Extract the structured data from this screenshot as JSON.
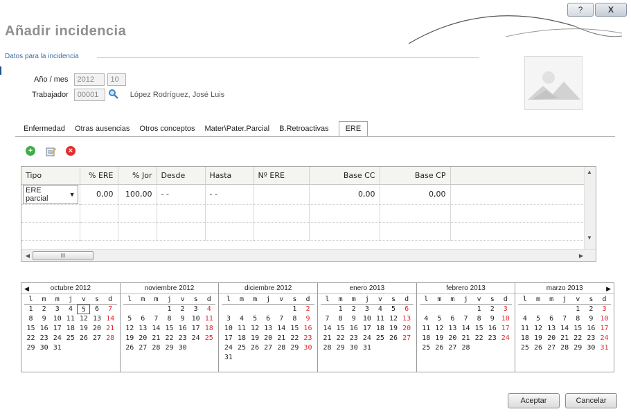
{
  "window": {
    "title": "Añadir incidencia",
    "help_glyph": "?",
    "close_glyph": "X"
  },
  "group": {
    "title": "Datos para la incidencia"
  },
  "form": {
    "anio_mes_label": "Año / mes",
    "anio_value": "2012",
    "mes_value": "10",
    "trabajador_label": "Trabajador",
    "trabajador_value": "00001",
    "trabajador_name": "López Rodríguez, José Luis"
  },
  "tabs": [
    {
      "label": "Enfermedad",
      "active": false
    },
    {
      "label": "Otras ausencias",
      "active": false
    },
    {
      "label": "Otros conceptos",
      "active": false
    },
    {
      "label": "Mater\\Pater.Parcial",
      "active": false
    },
    {
      "label": "B.Retroactivas",
      "active": false
    },
    {
      "label": "ERE",
      "active": true
    }
  ],
  "toolbar": {
    "icons": [
      "add-icon",
      "edit-icon",
      "delete-icon"
    ]
  },
  "grid": {
    "columns": [
      "Tipo",
      "% ERE",
      "% Jor",
      "Desde",
      "Hasta",
      "Nº ERE",
      "Base CC",
      "Base CP"
    ],
    "rows": [
      {
        "tipo": "ERE parcial",
        "ere": "0,00",
        "jor": "100,00",
        "desde": "- -",
        "hasta": "- -",
        "nere": "",
        "basecc": "0,00",
        "basecp": "0,00"
      }
    ],
    "scroll_glyph": "III"
  },
  "calendar": {
    "day_headers": [
      "l",
      "m",
      "m",
      "j",
      "v",
      "s",
      "d"
    ],
    "months": [
      {
        "title": "octubre 2012",
        "offset": 0,
        "days": 31,
        "today": 5
      },
      {
        "title": "noviembre 2012",
        "offset": 3,
        "days": 30,
        "today": null
      },
      {
        "title": "diciembre 2012",
        "offset": 5,
        "days": 31,
        "today": null
      },
      {
        "title": "enero 2013",
        "offset": 1,
        "days": 31,
        "today": null
      },
      {
        "title": "febrero 2013",
        "offset": 4,
        "days": 28,
        "today": null
      },
      {
        "title": "marzo 2013",
        "offset": 4,
        "days": 31,
        "today": null
      }
    ]
  },
  "buttons": {
    "accept": "Aceptar",
    "cancel": "Cancelar"
  },
  "colors": {
    "accent": "#3b6ea5",
    "sunday": "#e0262b",
    "title": "#8f8f8f"
  }
}
